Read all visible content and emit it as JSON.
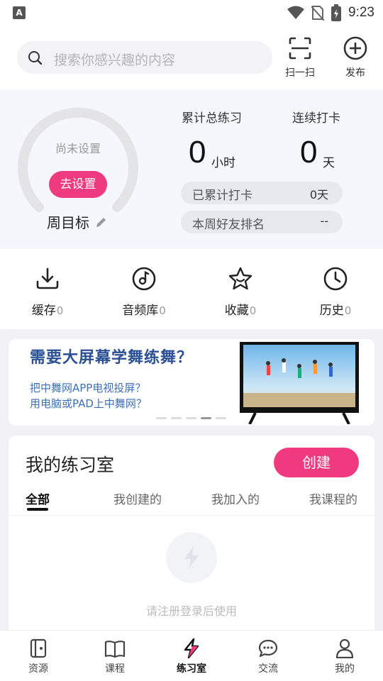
{
  "status_bar": {
    "app_badge": "A",
    "time": "9:23"
  },
  "header": {
    "search_placeholder": "搜索你感兴趣的内容",
    "scan_label": "扫一扫",
    "publish_label": "发布"
  },
  "stats": {
    "gauge_text": "尚未设置",
    "goal_button": "去设置",
    "goal_label": "周目标",
    "total_title": "累计总练习",
    "total_value": "0",
    "total_unit": "小时",
    "streak_title": "连续打卡",
    "streak_value": "0",
    "streak_unit": "天",
    "checkin_label": "已累计打卡",
    "checkin_value": "0天",
    "rank_label": "本周好友排名",
    "rank_value": "--"
  },
  "quick": [
    {
      "label": "缓存",
      "count": "0",
      "icon": "download-icon"
    },
    {
      "label": "音频库",
      "count": "0",
      "icon": "music-disc-icon"
    },
    {
      "label": "收藏",
      "count": "0",
      "icon": "star-icon"
    },
    {
      "label": "历史",
      "count": "0",
      "icon": "clock-icon"
    }
  ],
  "banner": {
    "title": "需要大屏幕学舞练舞？",
    "line1": "把中舞网APP电视投屏？",
    "line2": "用电脑或PAD上中舞网？",
    "active_dot": 3
  },
  "room": {
    "title": "我的练习室",
    "create_button": "创建",
    "tabs": [
      "全部",
      "我创建的",
      "我加入的",
      "我课程的"
    ],
    "active_tab": 0,
    "empty_text": "请注册登录后使用"
  },
  "bottom_nav": [
    {
      "label": "资源",
      "icon": "resource-icon"
    },
    {
      "label": "课程",
      "icon": "book-icon"
    },
    {
      "label": "练习室",
      "icon": "lightning-icon",
      "active": true
    },
    {
      "label": "交流",
      "icon": "chat-icon"
    },
    {
      "label": "我的",
      "icon": "user-icon"
    }
  ],
  "colors": {
    "accent": "#ef3a80",
    "banner_title": "#2a4f93"
  }
}
